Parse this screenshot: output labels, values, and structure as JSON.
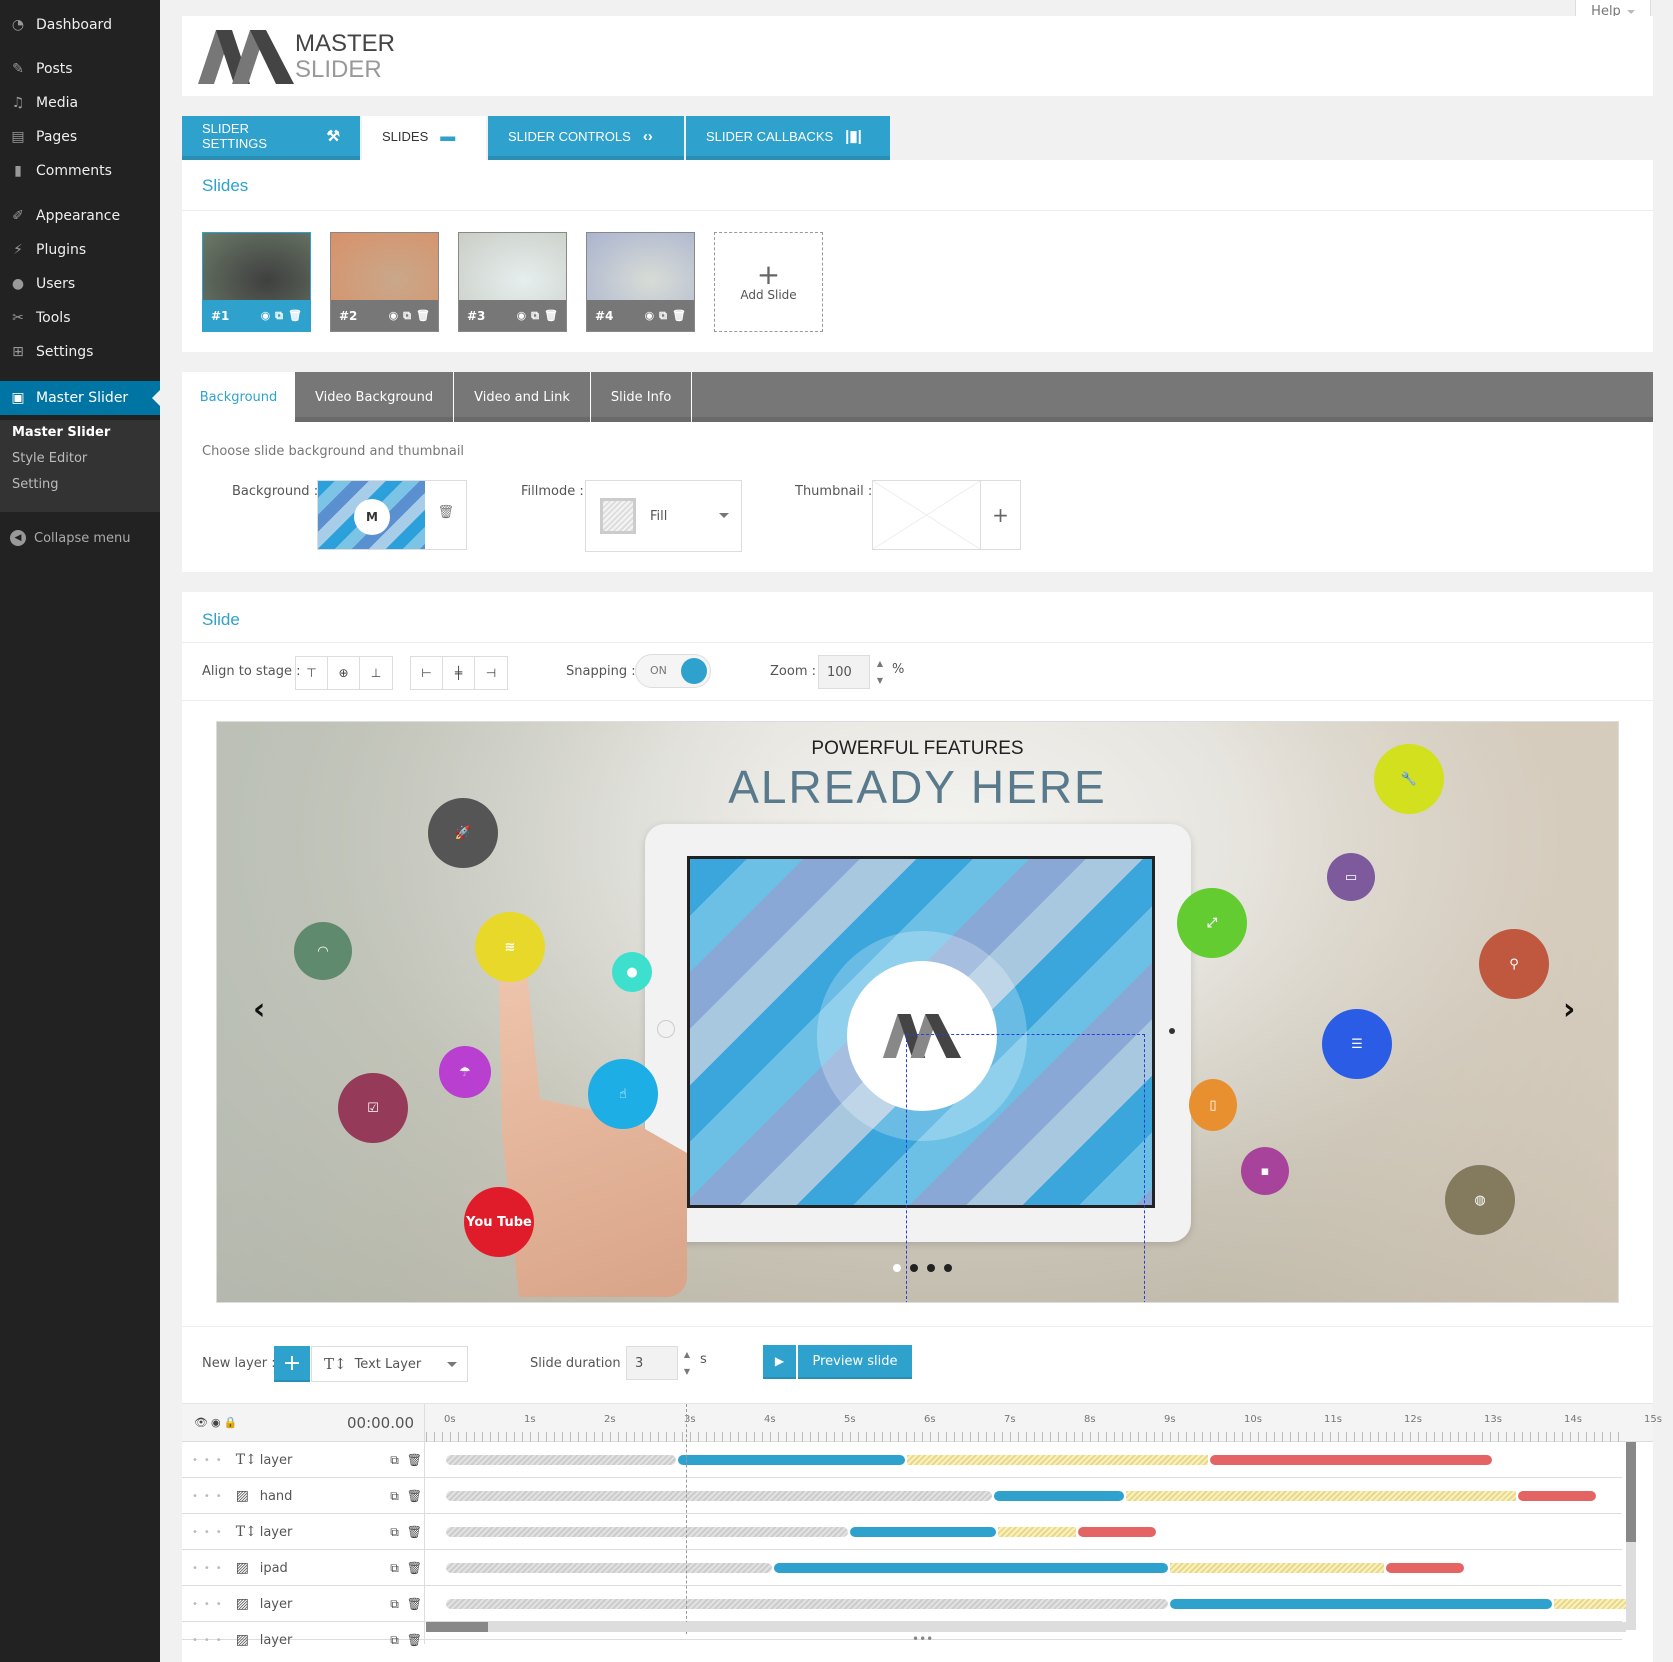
{
  "sidebar": {
    "items": [
      {
        "label": "Dashboard",
        "icon": "dashboard-icon"
      },
      {
        "label": "Posts",
        "icon": "pin-icon"
      },
      {
        "label": "Media",
        "icon": "media-icon"
      },
      {
        "label": "Pages",
        "icon": "pages-icon"
      },
      {
        "label": "Comments",
        "icon": "comment-icon"
      },
      {
        "label": "Appearance",
        "icon": "brush-icon"
      },
      {
        "label": "Plugins",
        "icon": "plugin-icon"
      },
      {
        "label": "Users",
        "icon": "user-icon"
      },
      {
        "label": "Tools",
        "icon": "wrench-icon"
      },
      {
        "label": "Settings",
        "icon": "settings-icon"
      },
      {
        "label": "Master Slider",
        "icon": "slider-icon"
      }
    ],
    "submenu": [
      "Master Slider",
      "Style Editor",
      "Setting"
    ],
    "collapse": "Collapse menu"
  },
  "help": "Help",
  "logo": {
    "line1": "MASTER",
    "line2": "SLIDER"
  },
  "top_tabs": [
    {
      "label": "SLIDER SETTINGS",
      "icon": "wrench-icon",
      "glyph": "🔧"
    },
    {
      "label": "SLIDES",
      "icon": "slides-icon",
      "glyph": "▭"
    },
    {
      "label": "SLIDER CONTROLS",
      "icon": "code-arrows-icon",
      "glyph": "‹›"
    },
    {
      "label": "SLIDER CALLBACKS",
      "icon": "barcode-icon",
      "glyph": "|▮|"
    }
  ],
  "slides_section": {
    "title": "Slides",
    "thumbs": [
      {
        "label": "#1",
        "color_a": "#3f3f3f",
        "color_b": "#6b7a68"
      },
      {
        "label": "#2",
        "color_a": "#c9a88a",
        "color_b": "#d8916a"
      },
      {
        "label": "#3",
        "color_a": "#e6eeee",
        "color_b": "#c9cdc5"
      },
      {
        "label": "#4",
        "color_a": "#d8dcd6",
        "color_b": "#aab4cf"
      }
    ],
    "add_label": "Add Slide"
  },
  "bg_tabs": [
    "Background",
    "Video Background",
    "Video and Link",
    "Slide Info"
  ],
  "bg_section": {
    "hint": "Choose slide background and thumbnail",
    "background_label": "Background :",
    "fillmode_label": "Fillmode :",
    "fillmode_value": "Fill",
    "thumbnail_label": "Thumbnail :"
  },
  "slide_section": {
    "title": "Slide",
    "align_label": "Align to stage :",
    "snapping_label": "Snapping :",
    "snapping_value": "ON",
    "zoom_label": "Zoom :",
    "zoom_value": "100",
    "zoom_unit": "%"
  },
  "stage": {
    "heading1": "POWERFUL FEATURES",
    "heading2": "ALREADY HERE",
    "youtube": "You Tube"
  },
  "layer_bar": {
    "new_layer_label": "New layer :",
    "layer_type": "Text Layer",
    "duration_label": "Slide duration :",
    "duration_value": "3",
    "duration_unit": "s",
    "preview_label": "Preview slide"
  },
  "timeline": {
    "time_display": "00:00.00",
    "ticks": [
      "0s",
      "1s",
      "2s",
      "3s",
      "4s",
      "5s",
      "6s",
      "7s",
      "8s",
      "9s",
      "10s",
      "11s",
      "12s",
      "13s",
      "14s",
      "15s"
    ],
    "playhead_s": 3,
    "layers": [
      {
        "name": "layer",
        "type": "text",
        "segments": [
          [
            "gray",
            0,
            2.9
          ],
          [
            "blue",
            2.9,
            5.76
          ],
          [
            "yellow",
            5.76,
            9.55
          ],
          [
            "red",
            9.55,
            13.1
          ]
        ]
      },
      {
        "name": "hand",
        "type": "image",
        "segments": [
          [
            "gray",
            0,
            6.85
          ],
          [
            "blue",
            6.85,
            8.5
          ],
          [
            "yellow",
            8.5,
            13.4
          ],
          [
            "red",
            13.4,
            14.4
          ]
        ]
      },
      {
        "name": "layer",
        "type": "text",
        "segments": [
          [
            "gray",
            0,
            5.05
          ],
          [
            "blue",
            5.05,
            6.9
          ],
          [
            "yellow",
            6.9,
            7.9
          ],
          [
            "red",
            7.9,
            8.9
          ]
        ]
      },
      {
        "name": "ipad",
        "type": "image",
        "segments": [
          [
            "gray",
            0,
            4.1
          ],
          [
            "blue",
            4.1,
            9.05
          ],
          [
            "yellow",
            9.05,
            11.75
          ],
          [
            "red",
            11.75,
            12.75
          ]
        ]
      },
      {
        "name": "layer",
        "type": "image",
        "segments": [
          [
            "gray",
            0,
            9.05
          ],
          [
            "blue",
            9.05,
            13.85
          ],
          [
            "yellow",
            13.85,
            14.8
          ]
        ]
      },
      {
        "name": "layer",
        "type": "image",
        "segments": []
      }
    ]
  },
  "colors": {
    "accent": "#2ea2cc",
    "sidebar": "#222222",
    "wp_active": "#0074a2"
  }
}
